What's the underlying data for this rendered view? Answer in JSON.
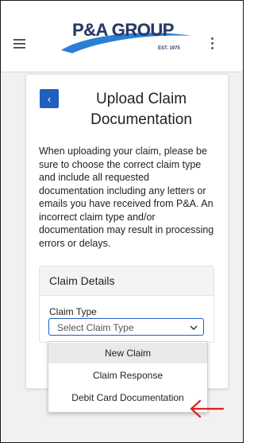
{
  "header": {
    "logo_text": "P&A GROUP",
    "logo_est": "EST. 1975"
  },
  "page": {
    "title": "Upload Claim Documentation",
    "description": "When uploading your claim, please be sure to choose the correct claim type and include all requested documentation including any letters or emails you have received from P&A. An incorrect claim type and/or documentation may result in processing errors or delays."
  },
  "claim_details": {
    "heading": "Claim Details",
    "claim_type_label": "Claim Type",
    "select_value": "Select Claim Type",
    "options": [
      "New Claim",
      "Claim Response",
      "Debit Card Documentation"
    ]
  },
  "colors": {
    "brand_navy": "#2a3a66",
    "accent_blue": "#1f5fbf",
    "annotation_red": "#e02020"
  },
  "icons": {
    "menu": "hamburger-icon",
    "more": "kebab-icon",
    "back": "chevron-left-icon",
    "dropdown": "chevron-down-icon",
    "annotation": "arrow-left-icon"
  }
}
